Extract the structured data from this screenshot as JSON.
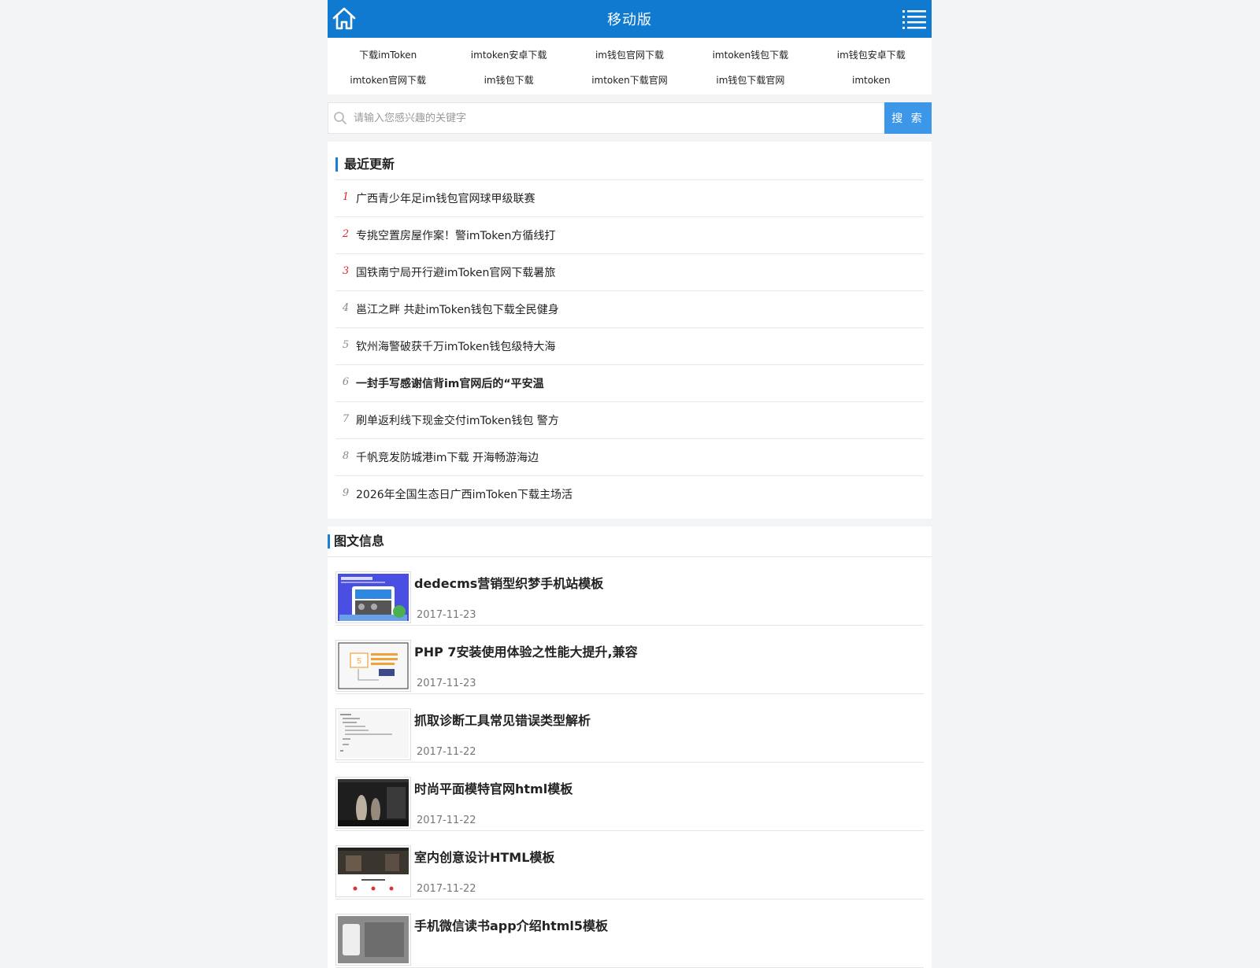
{
  "header": {
    "title": "移动版"
  },
  "links": [
    "下载imToken",
    "imtoken安卓下载",
    "im钱包官网下载",
    "imtoken钱包下载",
    "im钱包安卓下载",
    "imtoken官网下载",
    "im钱包下载",
    "imtoken下载官网",
    "im钱包下载官网",
    "imtoken"
  ],
  "search": {
    "placeholder": "请输入您感兴趣的关键字",
    "button": "搜 索"
  },
  "recent": {
    "title": "最近更新",
    "items": [
      {
        "num": "1",
        "text": "广西青少年足im钱包官网球甲级联赛"
      },
      {
        "num": "2",
        "text": "专挑空置房屋作案！警imToken方循线打"
      },
      {
        "num": "3",
        "text": "国铁南宁局开行避imToken官网下载暑旅"
      },
      {
        "num": "4",
        "text": "邕江之畔 共赴imToken钱包下载全民健身"
      },
      {
        "num": "5",
        "text": "钦州海警破获千万imToken钱包级特大海"
      },
      {
        "num": "6",
        "text": "一封手写感谢信背im官网后的“平安温"
      },
      {
        "num": "7",
        "text": "刷单返利线下现金交付imToken钱包 警方"
      },
      {
        "num": "8",
        "text": "千帆竞发防城港im下载 开海畅游海边"
      },
      {
        "num": "9",
        "text": "2026年全国生态日广西imToken下载主场活"
      }
    ]
  },
  "pics": {
    "title": "图文信息",
    "items": [
      {
        "title": "dedecms营销型织梦手机站模板",
        "date": "2017-11-23"
      },
      {
        "title": "PHP 7安装使用体验之性能大提升,兼容",
        "date": "2017-11-23"
      },
      {
        "title": "抓取诊断工具常见错误类型解析",
        "date": "2017-11-22"
      },
      {
        "title": "时尚平面模特官网html模板",
        "date": "2017-11-22"
      },
      {
        "title": "室内创意设计HTML模板",
        "date": "2017-11-22"
      },
      {
        "title": "手机微信读书app介绍html5模板",
        "date": ""
      }
    ]
  },
  "colors": {
    "brand": "#0f7ad0",
    "search_button": "#3d97e8",
    "hot_number": "#d62a2a"
  }
}
